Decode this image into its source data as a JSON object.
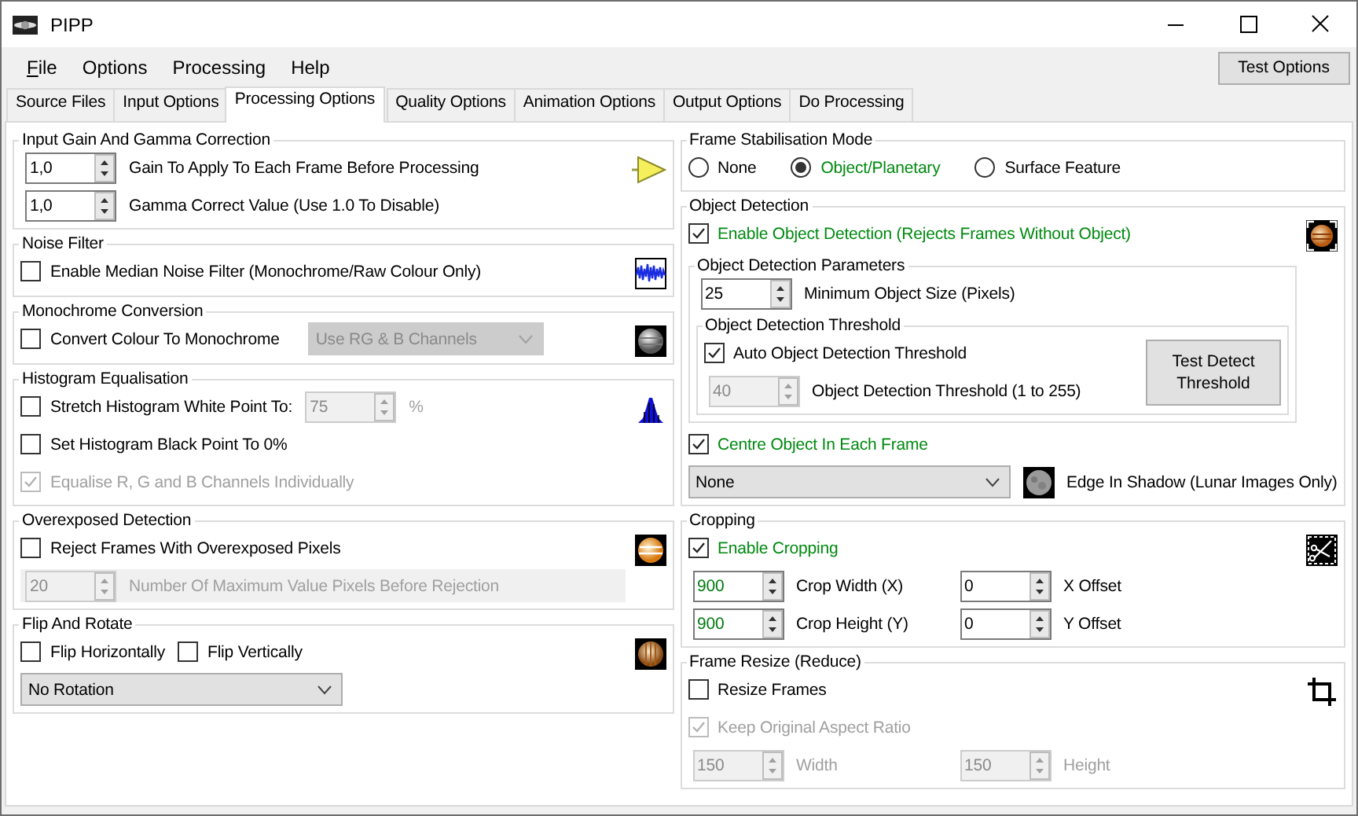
{
  "window": {
    "title": "PIPP"
  },
  "menu": [
    {
      "label": "File",
      "mnemonic": true
    },
    {
      "label": "Options",
      "mnemonic": false
    },
    {
      "label": "Processing",
      "mnemonic": false
    },
    {
      "label": "Help",
      "mnemonic": false
    }
  ],
  "toolbar_button": "Test Options",
  "tabs": [
    {
      "label": "Source Files",
      "selected": false
    },
    {
      "label": "Input Options",
      "selected": false
    },
    {
      "label": "Processing Options",
      "selected": true
    },
    {
      "label": "Quality Options",
      "selected": false
    },
    {
      "label": "Animation Options",
      "selected": false
    },
    {
      "label": "Output Options",
      "selected": false
    },
    {
      "label": "Do Processing",
      "selected": false
    }
  ],
  "left_column": [
    {
      "title": "Input Gain And Gamma Correction",
      "rows": [
        {
          "kind": "line",
          "controls": [
            {
              "kind": "spin",
              "value": "1,0",
              "disabled": false
            },
            {
              "kind": "label",
              "text": "Gain To Apply To Each Frame Before Processing",
              "disabled": false
            }
          ]
        },
        {
          "kind": "line",
          "controls": [
            {
              "kind": "spin",
              "value": "1,0",
              "disabled": false
            },
            {
              "kind": "label",
              "text": "Gamma Correct Value (Use 1.0 To Disable)",
              "disabled": false
            }
          ]
        }
      ]
    },
    {
      "title": "Noise Filter",
      "rows": [
        {
          "kind": "line",
          "controls": [
            {
              "kind": "check",
              "label": "Enable Median Noise Filter (Monochrome/Raw Colour Only)",
              "checked": false,
              "disabled": false
            }
          ]
        }
      ]
    },
    {
      "title": "Monochrome Conversion",
      "rows": [
        {
          "kind": "line",
          "controls": [
            {
              "kind": "check",
              "label": "Convert Colour To Monochrome",
              "checked": false,
              "disabled": false
            },
            {
              "kind": "select",
              "value": "Use RG & B Channels",
              "disabled": true
            }
          ]
        }
      ]
    },
    {
      "title": "Histogram Equalisation",
      "rows": [
        {
          "kind": "line",
          "controls": [
            {
              "kind": "check",
              "label": "Stretch Histogram White Point To:",
              "checked": false,
              "disabled": false
            },
            {
              "kind": "spin",
              "value": "75",
              "disabled": true
            },
            {
              "kind": "label",
              "text": "%",
              "disabled": true
            }
          ]
        },
        {
          "kind": "line",
          "controls": [
            {
              "kind": "check",
              "label": "Set Histogram Black Point To 0%",
              "checked": false,
              "disabled": false
            }
          ]
        },
        {
          "kind": "line",
          "controls": [
            {
              "kind": "check",
              "label": "Equalise R, G and B Channels Individually",
              "checked": true,
              "disabled": true
            }
          ]
        }
      ]
    },
    {
      "title": "Overexposed Detection",
      "rows": [
        {
          "kind": "line",
          "controls": [
            {
              "kind": "check",
              "label": "Reject Frames With Overexposed Pixels",
              "checked": false,
              "disabled": false
            }
          ]
        },
        {
          "kind": "line",
          "disabled": true,
          "controls": [
            {
              "kind": "spin",
              "value": "20",
              "disabled": true
            },
            {
              "kind": "label",
              "text": "Number Of Maximum Value Pixels Before Rejection",
              "disabled": true
            }
          ]
        }
      ]
    },
    {
      "title": "Flip And Rotate",
      "rows": [
        {
          "kind": "line",
          "controls": [
            {
              "kind": "check",
              "label": "Flip Horizontally",
              "checked": false,
              "disabled": false
            },
            {
              "kind": "check",
              "label": "Flip Vertically",
              "checked": false,
              "disabled": false
            }
          ]
        },
        {
          "kind": "line",
          "controls": [
            {
              "kind": "select",
              "value": "No Rotation",
              "disabled": false
            }
          ]
        }
      ]
    }
  ],
  "right_column": [
    {
      "title": "Frame Stabilisation Mode",
      "rows": [
        {
          "kind": "line",
          "controls": [
            {
              "kind": "radio",
              "label": "None",
              "selected": false
            },
            {
              "kind": "radio",
              "label": "Object/Planetary",
              "selected": true
            },
            {
              "kind": "radio",
              "label": "Surface Feature",
              "selected": false
            }
          ]
        }
      ]
    },
    {
      "title": "Object Detection",
      "rows": [
        {
          "kind": "line",
          "controls": [
            {
              "kind": "check",
              "label": "Enable Object Detection (Rejects Frames Without Object)",
              "checked": true,
              "disabled": false,
              "highlight": true
            }
          ]
        },
        {
          "kind": "group",
          "title": "Object Detection Parameters",
          "rows": [
            {
              "kind": "line",
              "controls": [
                {
                  "kind": "spin",
                  "value": "25",
                  "disabled": false
                },
                {
                  "kind": "label",
                  "text": "Minimum Object Size (Pixels)",
                  "disabled": false
                }
              ]
            },
            {
              "kind": "group",
              "title": "Object Detection Threshold",
              "action": "Test Detect Threshold",
              "rows": [
                {
                  "kind": "line",
                  "controls": [
                    {
                      "kind": "check",
                      "label": "Auto Object Detection Threshold",
                      "checked": true,
                      "disabled": false
                    }
                  ]
                },
                {
                  "kind": "line",
                  "controls": [
                    {
                      "kind": "spin",
                      "value": "40",
                      "disabled": true
                    },
                    {
                      "kind": "label",
                      "text": "Object Detection Threshold (1 to 255)",
                      "disabled": false
                    }
                  ]
                }
              ]
            }
          ]
        },
        {
          "kind": "line",
          "controls": [
            {
              "kind": "check",
              "label": "Centre Object In Each Frame",
              "checked": true,
              "disabled": false,
              "highlight": true
            }
          ]
        },
        {
          "kind": "line",
          "controls": [
            {
              "kind": "select",
              "value": "None",
              "disabled": false
            },
            {
              "kind": "image"
            },
            {
              "kind": "label",
              "text": "Edge In Shadow (Lunar Images Only)",
              "disabled": false
            }
          ]
        }
      ]
    },
    {
      "title": "Cropping",
      "rows": [
        {
          "kind": "line",
          "controls": [
            {
              "kind": "check",
              "label": "Enable Cropping",
              "checked": true,
              "disabled": false,
              "highlight": true
            }
          ]
        },
        {
          "kind": "line",
          "controls": [
            {
              "kind": "spin",
              "value": "900",
              "disabled": false,
              "highlight": true
            },
            {
              "kind": "label",
              "text": "Crop Width (X)",
              "disabled": false
            },
            {
              "kind": "spin",
              "value": "0",
              "disabled": false
            },
            {
              "kind": "label",
              "text": "X Offset",
              "disabled": false
            }
          ]
        },
        {
          "kind": "line",
          "controls": [
            {
              "kind": "spin",
              "value": "900",
              "disabled": false,
              "highlight": true
            },
            {
              "kind": "label",
              "text": "Crop Height (Y)",
              "disabled": false
            },
            {
              "kind": "spin",
              "value": "0",
              "disabled": false
            },
            {
              "kind": "label",
              "text": "Y Offset",
              "disabled": false
            }
          ]
        }
      ]
    },
    {
      "title": "Frame Resize (Reduce)",
      "rows": [
        {
          "kind": "line",
          "controls": [
            {
              "kind": "check",
              "label": "Resize Frames",
              "checked": false,
              "disabled": false
            }
          ]
        },
        {
          "kind": "line",
          "controls": [
            {
              "kind": "check",
              "label": "Keep Original Aspect Ratio",
              "checked": true,
              "disabled": true
            }
          ]
        },
        {
          "kind": "line",
          "controls": [
            {
              "kind": "spin",
              "value": "150",
              "disabled": true
            },
            {
              "kind": "label",
              "text": "Width",
              "disabled": true
            },
            {
              "kind": "spin",
              "value": "150",
              "disabled": true
            },
            {
              "kind": "label",
              "text": "Height",
              "disabled": true
            }
          ]
        }
      ]
    }
  ]
}
